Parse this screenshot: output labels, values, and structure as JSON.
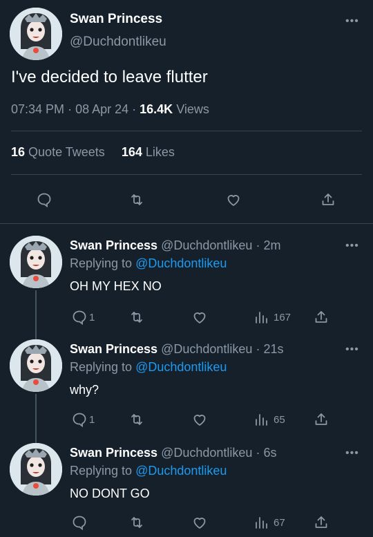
{
  "main": {
    "name": "Swan Princess",
    "handle": "@Duchdontlikeu",
    "text": "I've decided to leave flutter",
    "time": "07:34 PM",
    "date": "08 Apr 24",
    "views_count": "16.4K",
    "views_label": "Views",
    "quote_count": "16",
    "quote_label": "Quote Tweets",
    "likes_count": "164",
    "likes_label": "Likes"
  },
  "replies": [
    {
      "name": "Swan Princess",
      "handle": "@Duchdontlikeu",
      "sep": "·",
      "time": "2m",
      "replying_label": "Replying to",
      "replying_handle": "@Duchdontlikeu",
      "text": "OH MY HEX NO",
      "reply_count": "1",
      "views": "167"
    },
    {
      "name": "Swan Princess",
      "handle": "@Duchdontlikeu",
      "sep": "·",
      "time": "21s",
      "replying_label": "Replying to",
      "replying_handle": "@Duchdontlikeu",
      "text": "why?",
      "reply_count": "1",
      "views": "65"
    },
    {
      "name": "Swan Princess",
      "handle": "@Duchdontlikeu",
      "sep": "·",
      "time": "6s",
      "replying_label": "Replying to",
      "replying_handle": "@Duchdontlikeu",
      "text": "NO DONT GO",
      "reply_count": "",
      "views": "67"
    }
  ],
  "icons": {
    "more": "more-horizontal-icon",
    "reply": "reply-bubble-icon",
    "retweet": "retweet-icon",
    "like": "heart-icon",
    "share": "share-icon",
    "views": "views-bar-icon"
  },
  "colors": {
    "background": "#15202b",
    "muted": "#8b98a5",
    "link": "#1d9bf0",
    "divider": "#38444d"
  }
}
